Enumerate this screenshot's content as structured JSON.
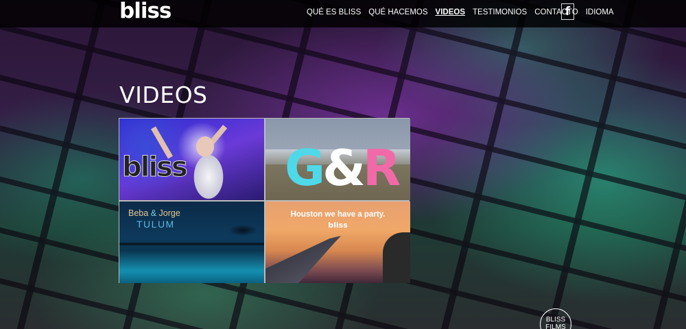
{
  "header": {
    "logo": "bliss",
    "nav": [
      {
        "label": "QUÉ ES BLISS"
      },
      {
        "label": "QUÉ HACEMOS"
      },
      {
        "label": "VIDEOS"
      },
      {
        "label": "TESTIMONIOS"
      },
      {
        "label": "CONTACTO"
      },
      {
        "label": "IDIOMA"
      }
    ],
    "active_nav": "VIDEOS",
    "facebook_icon": "f"
  },
  "main": {
    "title": "VIDEOS",
    "videos": [
      {
        "overlay": "bliss"
      },
      {
        "initial_1": "G",
        "amp": "&",
        "initial_2": "R"
      },
      {
        "line_1_a": "Beba",
        "line_1_amp": "&",
        "line_1_b": "Jorge",
        "line_2": "TULUM"
      },
      {
        "line_1": "Houston we have a party.",
        "line_2": "bliss"
      }
    ]
  },
  "badge": {
    "line_1": "BLISS",
    "line_2": "FILMS"
  },
  "colors": {
    "header_bg": "#000000",
    "accent_cyan": "#4fd9e8",
    "accent_pink": "#f06aa8"
  }
}
